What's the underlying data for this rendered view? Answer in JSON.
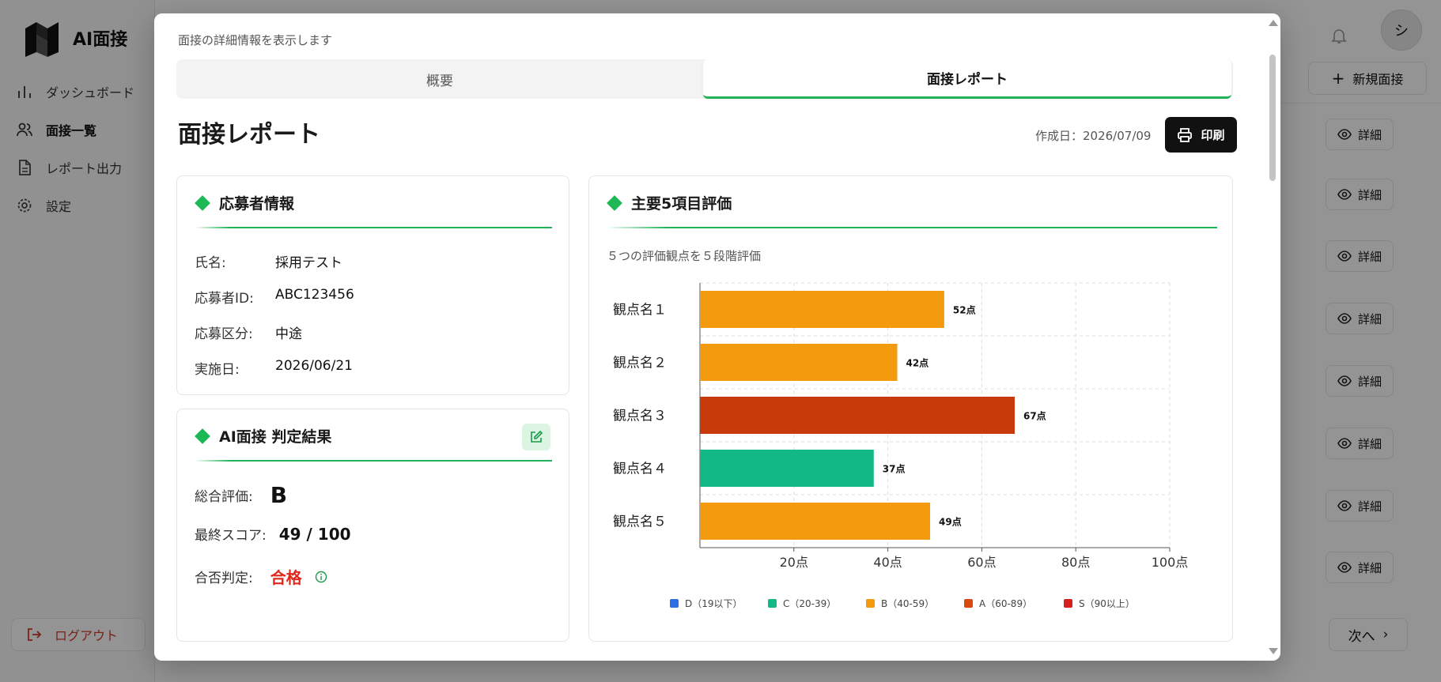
{
  "app": {
    "logo_text": "AI面接",
    "nav": [
      {
        "label": "ダッシュボード",
        "icon": "bar-chart-icon"
      },
      {
        "label": "面接一覧",
        "icon": "users-icon"
      },
      {
        "label": "レポート出力",
        "icon": "file-icon"
      },
      {
        "label": "設定",
        "icon": "gear-icon"
      }
    ],
    "logout_label": "ログアウト",
    "avatar_initial": "シ",
    "new_interview_label": "新規面接",
    "detail_label": "詳細",
    "next_label": "次へ"
  },
  "modal": {
    "subtitle": "面接の詳細情報を表示します",
    "tabs": [
      "概要",
      "面接レポート"
    ],
    "title": "面接レポート",
    "created_date": "作成日：2026/07/09",
    "print_label": "印刷"
  },
  "applicant": {
    "heading": "応募者情報",
    "rows": [
      {
        "label": "氏名:",
        "value": "採用テスト"
      },
      {
        "label": "応募者ID:",
        "value": "ABC123456"
      },
      {
        "label": "応募区分:",
        "value": "中途"
      },
      {
        "label": "実施日:",
        "value": "2026/06/21"
      }
    ]
  },
  "result": {
    "heading": "AI面接 判定結果",
    "overall_label": "総合評価:",
    "overall_value": "B",
    "score_label": "最終スコア:",
    "score_value": "49 / 100",
    "pass_label": "合否判定:",
    "pass_value": "合格"
  },
  "evaluation": {
    "heading": "主要5項目評価",
    "subtitle": "５つの評価観点を５段階評価"
  },
  "chart_data": {
    "type": "bar",
    "orientation": "horizontal",
    "categories": [
      "観点名１",
      "観点名２",
      "観点名３",
      "観点名４",
      "観点名５"
    ],
    "values": [
      52,
      42,
      67,
      37,
      49
    ],
    "value_labels": [
      "52点",
      "42点",
      "67点",
      "37点",
      "49点"
    ],
    "bar_colors": [
      "#f39a0f",
      "#f39a0f",
      "#c93a0a",
      "#12b886",
      "#f39a0f"
    ],
    "xlim": [
      0,
      100
    ],
    "x_ticks": [
      20,
      40,
      60,
      80,
      100
    ],
    "x_tick_labels": [
      "20点",
      "40点",
      "60点",
      "80点",
      "100点"
    ],
    "grid": true,
    "legend_position": "bottom",
    "legend": [
      {
        "label": "D（19以下）",
        "color": "#2f6fe4"
      },
      {
        "label": "C（20-39）",
        "color": "#12b886"
      },
      {
        "label": "B（40-59）",
        "color": "#f39a0f"
      },
      {
        "label": "A（60-89）",
        "color": "#d9480f"
      },
      {
        "label": "S（90以上）",
        "color": "#d61f1f"
      }
    ]
  }
}
